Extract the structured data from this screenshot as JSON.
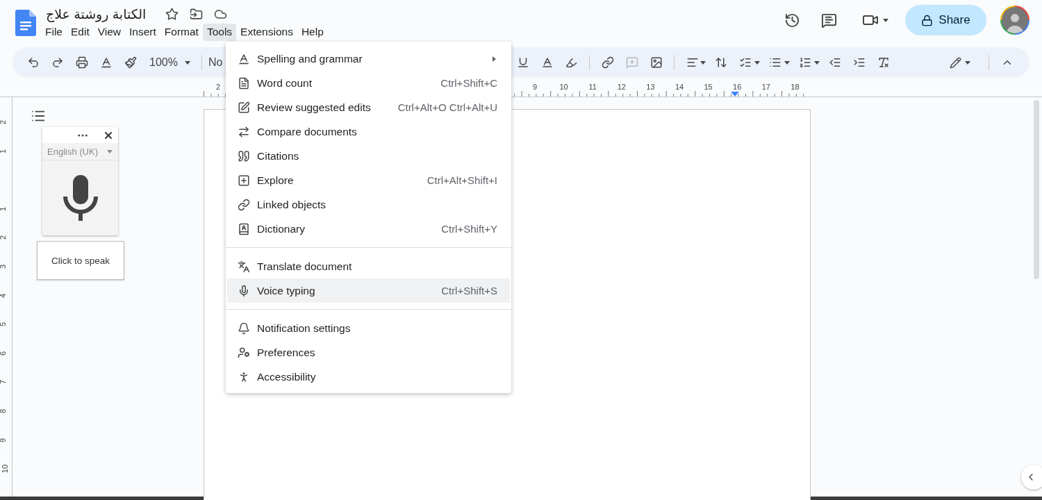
{
  "document": {
    "title": "الكتابة روشتة علاج"
  },
  "menu_bar": [
    {
      "label": "File",
      "selected": false
    },
    {
      "label": "Edit",
      "selected": false
    },
    {
      "label": "View",
      "selected": false
    },
    {
      "label": "Insert",
      "selected": false
    },
    {
      "label": "Format",
      "selected": false
    },
    {
      "label": "Tools",
      "selected": true
    },
    {
      "label": "Extensions",
      "selected": false
    },
    {
      "label": "Help",
      "selected": false
    }
  ],
  "share_button": {
    "label": "Share"
  },
  "toolbar": {
    "zoom": "100%",
    "style": "No"
  },
  "ruler": {
    "horizontal": [
      "2",
      "9",
      "10",
      "11",
      "12",
      "13",
      "14",
      "15",
      "16",
      "17",
      "18"
    ],
    "vertical": [
      "2",
      "1",
      "1",
      "2",
      "3",
      "4",
      "5",
      "6",
      "7",
      "8",
      "9",
      "10"
    ]
  },
  "voice_panel": {
    "language": "English (UK)",
    "tooltip": "Click to speak"
  },
  "tools_menu": {
    "groups": [
      [
        {
          "label": "Spelling and grammar",
          "has_submenu": true,
          "highlighted": false
        },
        {
          "label": "Word count",
          "shortcut": "Ctrl+Shift+C",
          "has_submenu": false,
          "highlighted": false
        },
        {
          "label": "Review suggested edits",
          "shortcut": "Ctrl+Alt+O Ctrl+Alt+U",
          "has_submenu": false,
          "highlighted": false
        },
        {
          "label": "Compare documents",
          "has_submenu": false,
          "highlighted": false
        },
        {
          "label": "Citations",
          "has_submenu": false,
          "highlighted": false
        },
        {
          "label": "Explore",
          "shortcut": "Ctrl+Alt+Shift+I",
          "has_submenu": false,
          "highlighted": false
        },
        {
          "label": "Linked objects",
          "has_submenu": false,
          "highlighted": false
        },
        {
          "label": "Dictionary",
          "shortcut": "Ctrl+Shift+Y",
          "has_submenu": false,
          "highlighted": false
        }
      ],
      [
        {
          "label": "Translate document",
          "has_submenu": false,
          "highlighted": false
        },
        {
          "label": "Voice typing",
          "shortcut": "Ctrl+Shift+S",
          "has_submenu": false,
          "highlighted": true
        }
      ],
      [
        {
          "label": "Notification settings",
          "has_submenu": false,
          "highlighted": false
        },
        {
          "label": "Preferences",
          "has_submenu": false,
          "highlighted": false
        },
        {
          "label": "Accessibility",
          "has_submenu": false,
          "highlighted": false
        }
      ]
    ]
  }
}
